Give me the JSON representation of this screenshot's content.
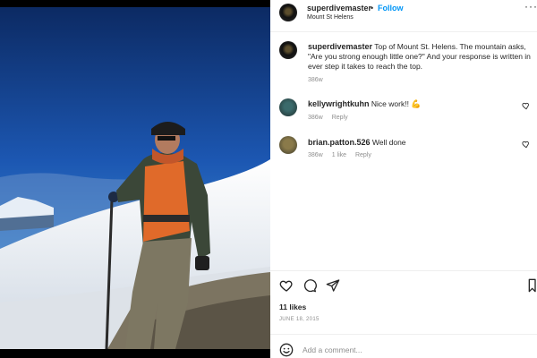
{
  "post": {
    "author": "superdivemaster",
    "follow_label": "Follow",
    "location": "Mount St Helens",
    "caption_author": "superdivemaster",
    "caption_text": "Top of Mount St. Helens. The mountain asks, \"Are you strong enough little one?\" And your response is written in ever step it takes to reach the top.",
    "caption_time": "386w",
    "likes": "11 likes",
    "date": "JUNE 18, 2015",
    "comment_placeholder": "Add a comment..."
  },
  "comments": [
    {
      "user": "kellywrightkuhn",
      "text": "Nice work!!",
      "time": "386w",
      "reply_label": "Reply"
    },
    {
      "user": "brian.patton.526",
      "text": "Well done",
      "time": "386w",
      "likes": "1 like",
      "reply_label": "Reply"
    }
  ],
  "colors": {
    "accent": "#0095f6",
    "text": "#262626",
    "muted": "#8e8e8e"
  }
}
